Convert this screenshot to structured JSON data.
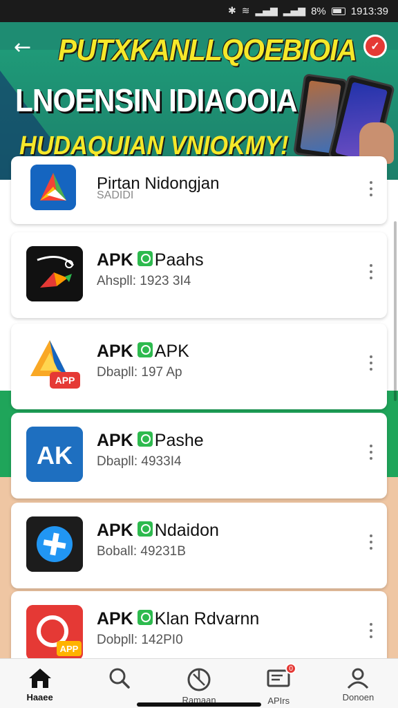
{
  "status_bar": {
    "time": "1913:39",
    "battery": "8%"
  },
  "hero": {
    "title": "PUTXKANLLQOEBIOIA",
    "subtitle1": "LNOENSIN IDIAOOIA",
    "subtitle2": "HUDAQUIAN VNIOKMY!"
  },
  "apps": [
    {
      "title": "Pirtan Nidongjan",
      "meta": "SADIDI",
      "icon": "play-triangle-icon"
    },
    {
      "title_prefix": "APK",
      "title_suffix": "Paahs",
      "meta": "Ahspll: 1923 3I4",
      "icon": "arrow-logo-icon"
    },
    {
      "title_prefix": "APK",
      "title_suffix": "APK",
      "meta": "Dbapll: 197 Ap",
      "icon": "apk-android-icon",
      "icon_text": "APP"
    },
    {
      "title_prefix": "APK",
      "title_suffix": "Pashe",
      "meta": "Dbapll: 4933I4",
      "icon": "ak-logo-icon",
      "icon_text": "AK"
    },
    {
      "title_prefix": "APK",
      "title_suffix": "Ndaidon",
      "meta": "Boball: 49231B",
      "icon": "plus-circle-icon"
    },
    {
      "title_prefix": "APK",
      "title_suffix": "Klan Rdvarnn",
      "meta": "Dobpll: 142PI0",
      "icon": "red-app-icon",
      "icon_text": "APP"
    }
  ],
  "tabs": [
    {
      "label": "Haaee",
      "icon": "home-icon",
      "active": true
    },
    {
      "label": "",
      "icon": "search-icon"
    },
    {
      "label": "Ramaan",
      "icon": "compass-icon"
    },
    {
      "label": "APIrs",
      "icon": "inbox-icon",
      "badge": "0"
    },
    {
      "label": "Donoen",
      "icon": "person-icon"
    }
  ],
  "colors": {
    "accent": "#2dba4e",
    "hero_bg": "#1e8c72",
    "hero_title": "#f5e82a"
  }
}
